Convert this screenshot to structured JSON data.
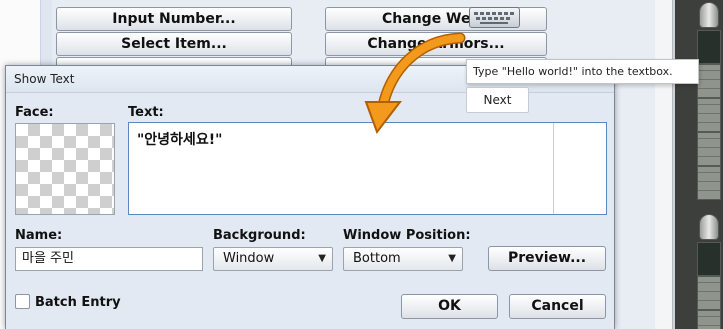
{
  "background_window": {
    "left_buttons": [
      "Input Number...",
      "Select Item...",
      ""
    ],
    "right_buttons": [
      "Change Weap",
      "Change Armors...",
      ""
    ]
  },
  "dialog": {
    "title": "Show Text",
    "face_label": "Face:",
    "text_label": "Text:",
    "text_value": "\"안녕하세요!\"",
    "name_label": "Name:",
    "name_value": "마을 주민",
    "background_label": "Background:",
    "background_value": "Window",
    "window_position_label": "Window Position:",
    "window_position_value": "Bottom",
    "preview_button": "Preview...",
    "batch_entry_label": "Batch Entry",
    "batch_entry_checked": false,
    "ok_button": "OK",
    "cancel_button": "Cancel"
  },
  "tutorial": {
    "tooltip_text": "Type \"Hello world!\" into the textbox.",
    "next_button": "Next",
    "arrow_color": "#f39a1c",
    "keyboard_icon": "keyboard-icon"
  }
}
